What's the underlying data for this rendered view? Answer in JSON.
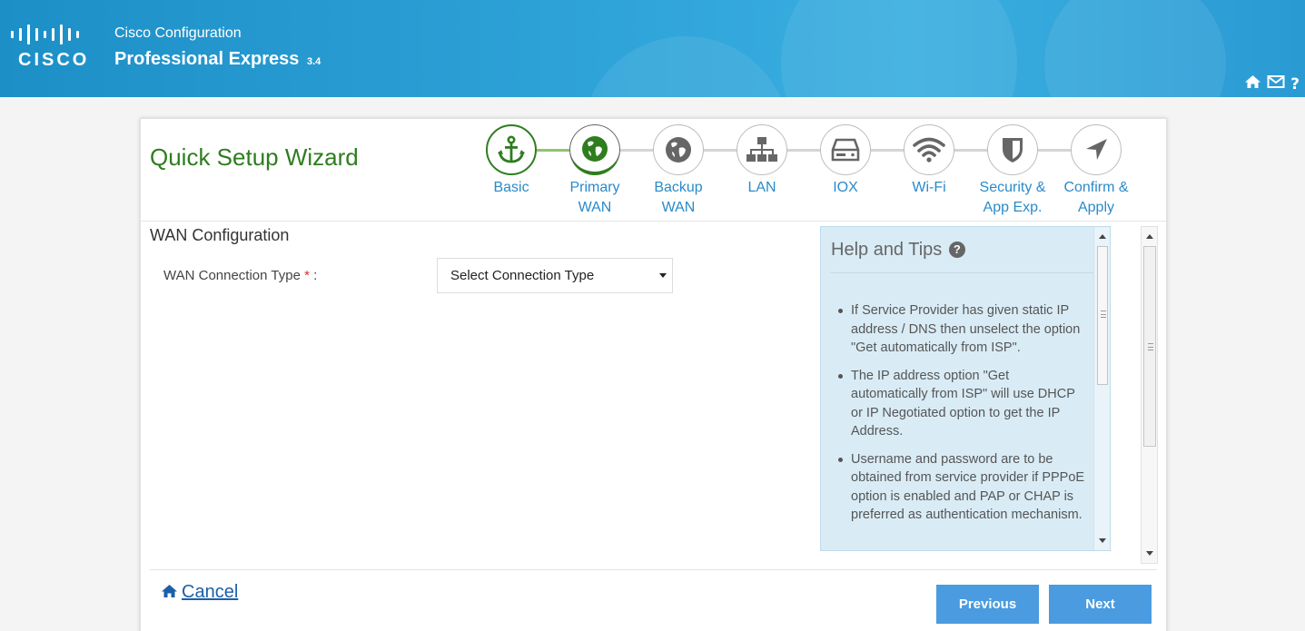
{
  "header": {
    "brand": "CISCO",
    "subtitle": "Cisco Configuration",
    "title": "Professional Express",
    "version": "3.4",
    "icons": [
      "home-icon",
      "mail-icon",
      "help-icon"
    ]
  },
  "wizard": {
    "title": "Quick Setup Wizard",
    "steps": [
      {
        "label1": "Basic",
        "label2": "",
        "icon": "anchor-icon",
        "state": "done"
      },
      {
        "label1": "Primary",
        "label2": "WAN",
        "icon": "globe-icon",
        "state": "current"
      },
      {
        "label1": "Backup",
        "label2": "WAN",
        "icon": "globe-icon",
        "state": "todo"
      },
      {
        "label1": "LAN",
        "label2": "",
        "icon": "network-icon",
        "state": "todo"
      },
      {
        "label1": "IOX",
        "label2": "",
        "icon": "drive-icon",
        "state": "todo"
      },
      {
        "label1": "Wi-Fi",
        "label2": "",
        "icon": "wifi-icon",
        "state": "todo"
      },
      {
        "label1": "Security &",
        "label2": "App Exp.",
        "icon": "shield-icon",
        "state": "todo"
      },
      {
        "label1": "Confirm &",
        "label2": "Apply",
        "icon": "location-arrow-icon",
        "state": "todo"
      }
    ]
  },
  "form": {
    "section_title": "WAN Configuration",
    "field_label": "WAN Connection Type",
    "required_mark": "*",
    "label_suffix": " :",
    "select_value": "Select Connection Type"
  },
  "help": {
    "title": "Help and Tips",
    "tips": [
      "If Service Provider has given static IP address / DNS then unselect the option \"Get automatically from ISP\".",
      "The IP address option \"Get automatically from ISP\" will use DHCP or IP Negotiated option to get the IP Address.",
      "Username and password are to be obtained from service provider if PPPoE option is enabled and PAP or CHAP is preferred as authentication mechanism."
    ]
  },
  "footer": {
    "cancel_label": "Cancel",
    "previous_label": "Previous",
    "next_label": "Next"
  },
  "colors": {
    "header_blue": "#2ea3d8",
    "wizard_green": "#2e7d1f",
    "step_label_blue": "#2a8ac9",
    "button_blue": "#4a9be0",
    "help_bg": "#d9ecf6"
  }
}
